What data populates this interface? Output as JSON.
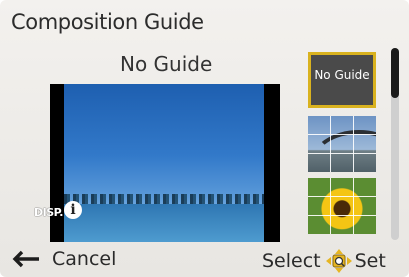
{
  "header": {
    "title": "Composition Guide"
  },
  "selection": {
    "name": "No Guide"
  },
  "preview": {
    "disp_label": "DISP."
  },
  "thumbnails": [
    {
      "label": "No Guide",
      "icon": "no-guide",
      "selected": true
    },
    {
      "label": "",
      "icon": "grid-bridge",
      "selected": false
    },
    {
      "label": "",
      "icon": "grid-flower",
      "selected": false
    }
  ],
  "footer": {
    "cancel_label": "Cancel",
    "select_label": "Select",
    "set_label": "Set"
  },
  "colors": {
    "selection_border": "#d9b21f",
    "dpad": "#e6b521"
  }
}
